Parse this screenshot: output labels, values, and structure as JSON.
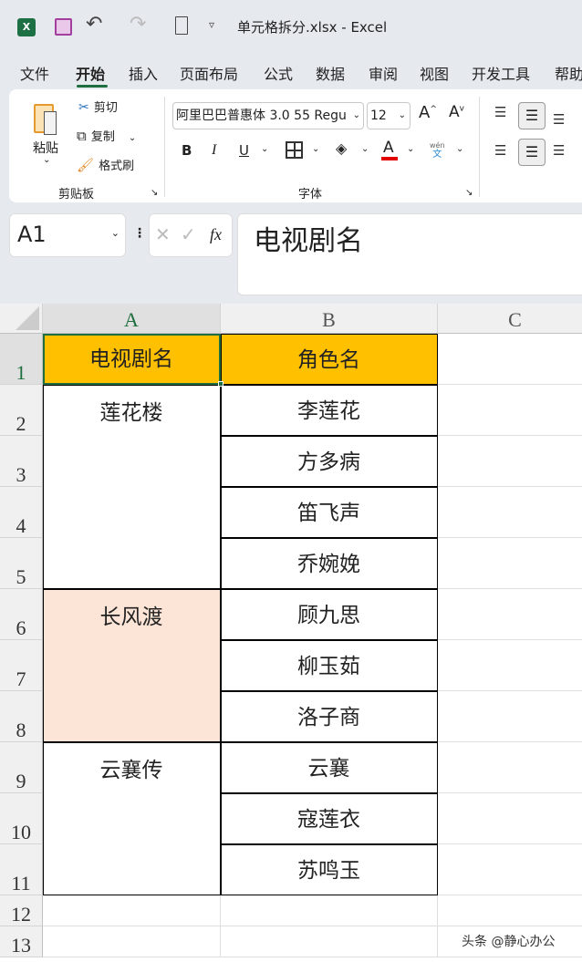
{
  "titlebar": {
    "title": "单元格拆分.xlsx  -  Excel",
    "icons": [
      "excel-logo",
      "save-icon",
      "undo-icon",
      "redo-icon",
      "print-preview-icon",
      "customize-icon"
    ]
  },
  "menu": {
    "tabs": [
      "文件",
      "开始",
      "插入",
      "页面布局",
      "公式",
      "数据",
      "审阅",
      "视图",
      "开发工具",
      "帮助"
    ],
    "active": "开始"
  },
  "ribbon": {
    "clipboard": {
      "paste": "粘贴",
      "cut": "剪切",
      "copy": "复制",
      "format_painter": "格式刷",
      "group": "剪贴板"
    },
    "font": {
      "font_name": "阿里巴巴普惠体 3.0 55 Regu",
      "font_size": "12",
      "bold": "B",
      "italic": "I",
      "underline": "U",
      "font_color_letter": "A",
      "phonetic_top": "wén",
      "phonetic_bottom": "文",
      "group": "字体",
      "font_color": "#e00000"
    }
  },
  "formula_bar": {
    "name_box": "A1",
    "fx": "fx",
    "content": "电视剧名"
  },
  "sheet": {
    "columns": [
      "A",
      "B",
      "C"
    ],
    "rows": [
      "1",
      "2",
      "3",
      "4",
      "5",
      "6",
      "7",
      "8",
      "9",
      "10",
      "11",
      "12",
      "13"
    ],
    "header": {
      "a": "电视剧名",
      "b": "角色名",
      "fill": "#ffc000"
    },
    "groups": [
      {
        "show": "莲花楼",
        "roles": [
          "李莲花",
          "方多病",
          "笛飞声",
          "乔婉娩"
        ],
        "fill": "#ffffff"
      },
      {
        "show": "长风渡",
        "roles": [
          "顾九思",
          "柳玉茹",
          "洛子商"
        ],
        "fill": "#fce4d6"
      },
      {
        "show": "云襄传",
        "roles": [
          "云襄",
          "寇莲衣",
          "苏鸣玉"
        ],
        "fill": "#ffffff"
      }
    ]
  },
  "watermark": "头条 @静心办公"
}
